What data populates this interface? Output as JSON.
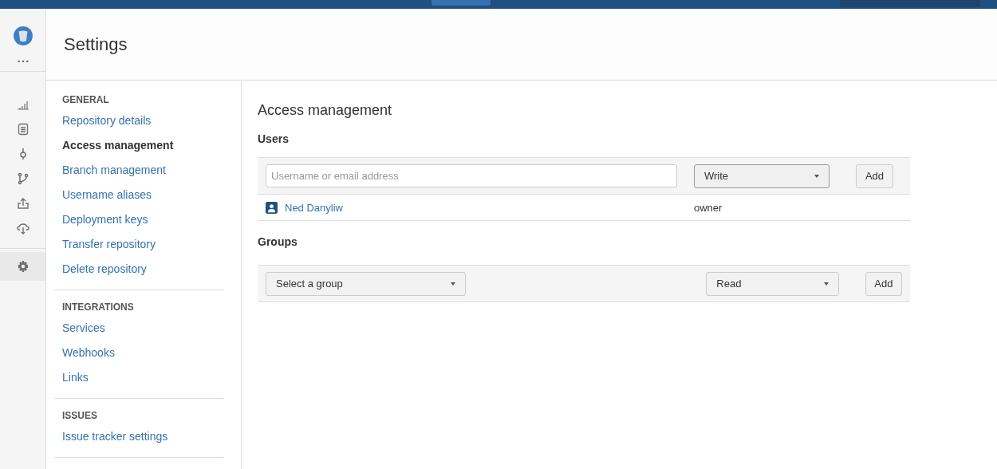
{
  "header": {
    "title": "Settings"
  },
  "rail": [
    {
      "kind": "chart",
      "selected": false
    },
    {
      "kind": "source",
      "selected": false
    },
    {
      "kind": "commits",
      "selected": false
    },
    {
      "kind": "branches",
      "selected": false
    },
    {
      "kind": "upload",
      "selected": false
    },
    {
      "kind": "cloud",
      "selected": false
    },
    {
      "kind": "settings",
      "selected": true
    }
  ],
  "sidebar": {
    "sections": [
      {
        "heading": "GENERAL",
        "items": [
          {
            "label": "Repository details",
            "selected": false
          },
          {
            "label": "Access management",
            "selected": true
          },
          {
            "label": "Branch management",
            "selected": false
          },
          {
            "label": "Username aliases",
            "selected": false
          },
          {
            "label": "Deployment keys",
            "selected": false
          },
          {
            "label": "Transfer repository",
            "selected": false
          },
          {
            "label": "Delete repository",
            "selected": false
          }
        ]
      },
      {
        "heading": "INTEGRATIONS",
        "items": [
          {
            "label": "Services",
            "selected": false
          },
          {
            "label": "Webhooks",
            "selected": false
          },
          {
            "label": "Links",
            "selected": false
          }
        ]
      },
      {
        "heading": "ISSUES",
        "items": [
          {
            "label": "Issue tracker settings",
            "selected": false
          }
        ]
      }
    ]
  },
  "main": {
    "title": "Access management",
    "users": {
      "heading": "Users",
      "input": {
        "placeholder": "Username or email address"
      },
      "permission": "Write",
      "button": "Add",
      "rows": [
        {
          "name": "Ned Danyliw",
          "role": "owner"
        }
      ]
    },
    "groups": {
      "heading": "Groups",
      "select": "Select a group",
      "permission": "Read",
      "button": "Add"
    }
  }
}
